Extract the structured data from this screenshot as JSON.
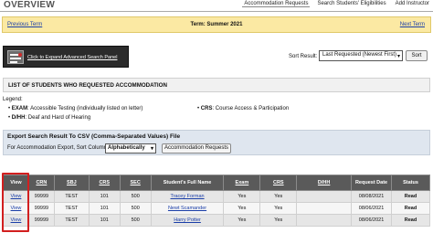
{
  "header": {
    "title": "OVERVIEW",
    "nav": [
      "Accommodation Requests",
      "Search Students' Eligibilities",
      "Add Instructor"
    ]
  },
  "term_bar": {
    "prev": "Previous Term",
    "current": "Term: Summer 2021",
    "next": "Next Term"
  },
  "advanced_search": {
    "label": "Click to Expand Advanced Search Panel",
    "icon": "search-panel-icon"
  },
  "sort": {
    "label": "Sort Result:",
    "selected": "Last Requested (Newest First)",
    "button": "Sort"
  },
  "section_title": "LIST OF STUDENTS WHO REQUESTED ACCOMMODATION",
  "legend": {
    "title": "Legend:",
    "exam_key": "EXAM",
    "exam_desc": ": Accessible Testing (individually listed on letter)",
    "dhh_key": "D/HH",
    "dhh_desc": ": Deaf and Hard of Hearing",
    "crs_key": "CRS",
    "crs_desc": ": Course Access & Participation"
  },
  "export": {
    "title": "Export Search Result To CSV (Comma-Separated Values) File",
    "sort_label": "For Accommodation Export, Sort Column by:",
    "selected": "Alphabetically",
    "button": "Accommodation Requests"
  },
  "table": {
    "headers": [
      "View",
      "CRN",
      "SBJ",
      "CRS",
      "SEC",
      "Student's Full Name",
      "Exam",
      "CRS",
      "D/HH",
      "Request Date",
      "Status"
    ],
    "rows": [
      {
        "view": "View",
        "crn": "99999",
        "sbj": "TEST",
        "crs": "101",
        "sec": "500",
        "name": "Tracey Forman",
        "exam": "Yes",
        "crs_acc": "Yes",
        "dhh": "",
        "date": "08/08/2021",
        "status": "Read"
      },
      {
        "view": "View",
        "crn": "99999",
        "sbj": "TEST",
        "crs": "101",
        "sec": "500",
        "name": "Newt Scamander",
        "exam": "Yes",
        "crs_acc": "Yes",
        "dhh": "",
        "date": "08/06/2021",
        "status": "Read"
      },
      {
        "view": "View",
        "crn": "99999",
        "sbj": "TEST",
        "crs": "101",
        "sec": "500",
        "name": "Harry Potter",
        "exam": "Yes",
        "crs_acc": "Yes",
        "dhh": "",
        "date": "08/06/2021",
        "status": "Read"
      }
    ]
  },
  "colors": {
    "term_bar": "#fbe9a3",
    "table_header": "#5a5a5a",
    "export_bg": "#dfe6ef",
    "link": "#1a3ea8",
    "highlight": "#d21f1f"
  }
}
